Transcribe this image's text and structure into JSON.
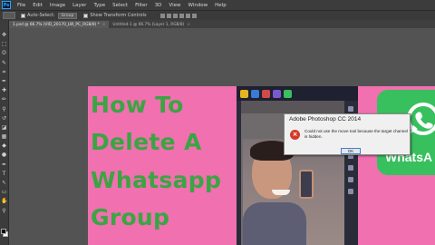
{
  "app": {
    "logo_text": "Ps",
    "menu": [
      "File",
      "Edit",
      "Image",
      "Layer",
      "Type",
      "Select",
      "Filter",
      "3D",
      "View",
      "Window",
      "Help"
    ]
  },
  "options_bar": {
    "auto_select_label": "Auto-Select:",
    "auto_select_value": "Group",
    "show_transform_label": "Show Transform Controls"
  },
  "tabs": [
    {
      "label": "1.psd @ 66.7% (VID_20170_LW_PC_RGB/8) *",
      "active": true
    },
    {
      "label": "Untitled-1 @ 66.7% (Layer 1, RGB/8)",
      "active": false
    }
  ],
  "toolbar": {
    "tools": [
      "move-tool-icon",
      "marquee-tool-icon",
      "lasso-tool-icon",
      "quick-select-tool-icon",
      "crop-tool-icon",
      "eyedropper-tool-icon",
      "healing-brush-tool-icon",
      "brush-tool-icon",
      "clone-stamp-tool-icon",
      "history-brush-tool-icon",
      "eraser-tool-icon",
      "gradient-tool-icon",
      "blur-tool-icon",
      "dodge-tool-icon",
      "pen-tool-icon",
      "type-tool-icon",
      "path-select-tool-icon",
      "shape-tool-icon",
      "hand-tool-icon",
      "zoom-tool-icon"
    ],
    "glyphs": [
      "✥",
      "⬚",
      "ʘ",
      "✎",
      "⌗",
      "✒",
      "✚",
      "✏",
      "⚲",
      "↺",
      "◪",
      "▦",
      "◆",
      "●",
      "✒",
      "T",
      "↖",
      "▭",
      "✋",
      "⚲"
    ]
  },
  "canvas": {
    "background": "#f070b0",
    "text_color": "#3aa542",
    "title_lines": [
      "How To",
      "Delete A",
      "Whatsapp",
      "Group"
    ]
  },
  "dialog": {
    "title": "Adobe Photoshop CC 2014",
    "message": "Could not use the move tool because the target channel is hidden.",
    "ok_label": "OK"
  },
  "whatsapp_logo": {
    "text": "WhatsA",
    "color": "#37c05d"
  }
}
